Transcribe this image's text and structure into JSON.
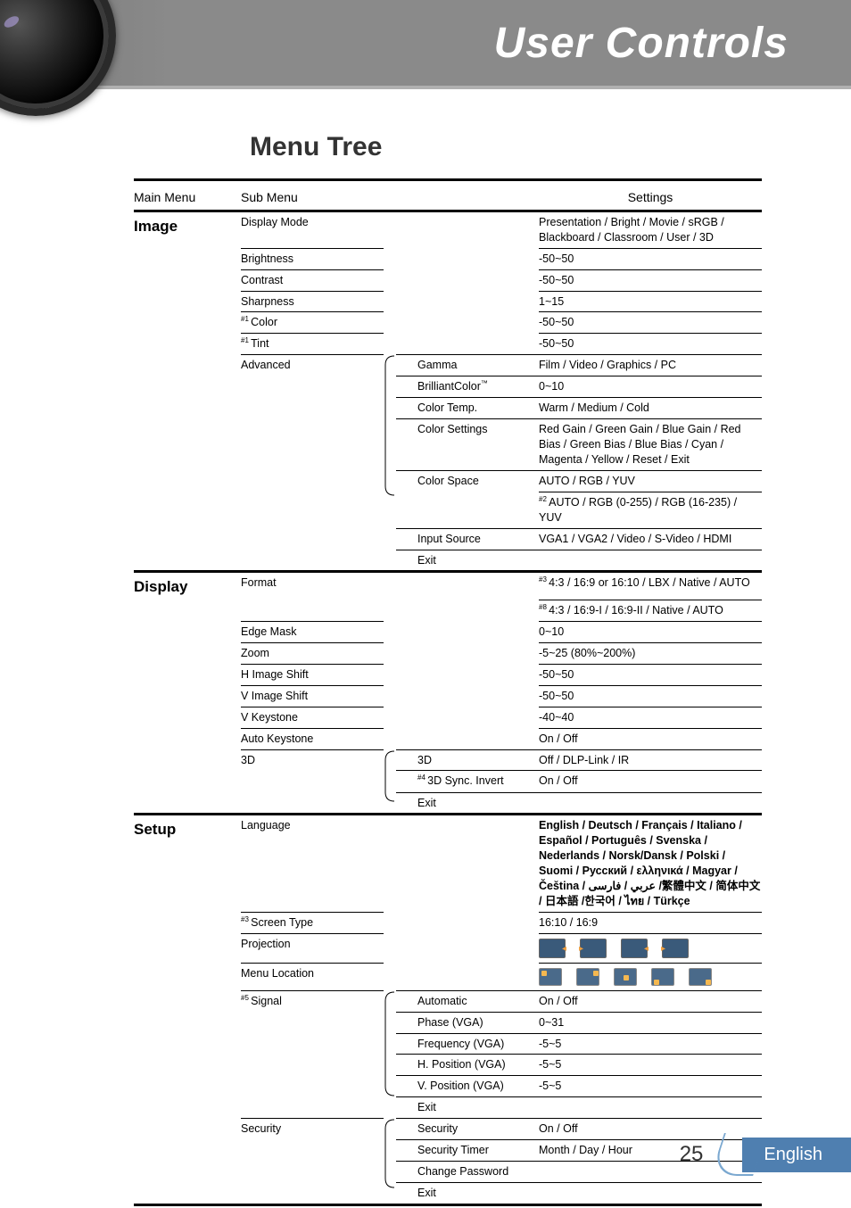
{
  "banner": {
    "title": "User Controls"
  },
  "page": {
    "title": "Menu Tree",
    "number": "25",
    "language": "English"
  },
  "headers": {
    "main": "Main Menu",
    "sub": "Sub Menu",
    "settings": "Settings"
  },
  "sections": [
    {
      "name": "Image",
      "rows": [
        {
          "sub": "Display Mode",
          "mid": "",
          "set": "Presentation / Bright / Movie / sRGB / Blackboard / Classroom / User / 3D"
        },
        {
          "sub": "Brightness",
          "mid": "",
          "set": "-50~50"
        },
        {
          "sub": "Contrast",
          "mid": "",
          "set": "-50~50"
        },
        {
          "sub": "Sharpness",
          "mid": "",
          "set": "1~15"
        },
        {
          "subPrefix": "#1 ",
          "sub": "Color",
          "mid": "",
          "set": "-50~50"
        },
        {
          "subPrefix": "#1 ",
          "sub": "Tint",
          "mid": "",
          "set": "-50~50"
        },
        {
          "sub": "Advanced",
          "mid": "Gamma",
          "set": "Film / Video / Graphics / PC",
          "braceStart": true
        },
        {
          "sub": "",
          "mid": "BrilliantColor™",
          "set": "0~10"
        },
        {
          "sub": "",
          "mid": "Color Temp.",
          "set": "Warm / Medium / Cold"
        },
        {
          "sub": "",
          "mid": "Color Settings",
          "set": "Red Gain / Green Gain / Blue Gain / Red Bias / Green Bias / Blue Bias / Cyan / Magenta / Yellow / Reset / Exit"
        },
        {
          "sub": "",
          "mid": "Color Space",
          "set": "AUTO / RGB / YUV"
        },
        {
          "sub": "",
          "mid": "",
          "setPrefix": "#2 ",
          "set": "AUTO / RGB (0-255) / RGB (16-235) / YUV"
        },
        {
          "sub": "",
          "mid": "Input Source",
          "set": "VGA1 / VGA2 / Video / S-Video / HDMI"
        },
        {
          "sub": "",
          "mid": "Exit",
          "set": "",
          "braceEnd": true
        }
      ]
    },
    {
      "name": "Display",
      "rows": [
        {
          "sub": "Format",
          "mid": "",
          "setPrefix": "#3 ",
          "set": "4:3 / 16:9 or 16:10 / LBX / Native / AUTO"
        },
        {
          "sub": "",
          "mid": "",
          "setPrefix": "#8 ",
          "set": "4:3 / 16:9-I / 16:9-II / Native / AUTO"
        },
        {
          "sub": "Edge Mask",
          "mid": "",
          "set": "0~10"
        },
        {
          "sub": "Zoom",
          "mid": "",
          "set": "-5~25 (80%~200%)"
        },
        {
          "sub": "H Image Shift",
          "mid": "",
          "set": "-50~50"
        },
        {
          "sub": "V Image Shift",
          "mid": "",
          "set": "-50~50"
        },
        {
          "sub": "V Keystone",
          "mid": "",
          "set": "-40~40"
        },
        {
          "sub": "Auto Keystone",
          "mid": "",
          "set": "On / Off"
        },
        {
          "sub": "3D",
          "mid": "3D",
          "set": "Off / DLP-Link / IR",
          "braceStart": true
        },
        {
          "sub": "",
          "midPrefix": "#4 ",
          "mid": "3D Sync. Invert",
          "set": "On / Off"
        },
        {
          "sub": "",
          "mid": "Exit",
          "set": "",
          "braceEnd": true
        }
      ]
    },
    {
      "name": "Setup",
      "rows": [
        {
          "sub": "Language",
          "mid": "",
          "set": "English / Deutsch / Français / Italiano / Español / Português / Svenska / Nederlands / Norsk/Dansk / Polski / Suomi / Русский / ελληνικά / Magyar / Čeština / عربي / فارسی /繁體中文 / 简体中文 / 日本語 /한국어 / ไทย / Türkçe",
          "bold": true
        },
        {
          "subPrefix": "#3 ",
          "sub": "Screen Type",
          "mid": "",
          "set": "16:10 / 16:9"
        },
        {
          "sub": "Projection",
          "mid": "",
          "set": "",
          "projection": true
        },
        {
          "sub": "Menu Location",
          "mid": "",
          "set": "",
          "menulocation": true
        },
        {
          "subPrefix": "#5 ",
          "sub": "Signal",
          "mid": "Automatic",
          "set": "On / Off",
          "braceStart": true
        },
        {
          "sub": "",
          "mid": "Phase (VGA)",
          "set": "0~31"
        },
        {
          "sub": "",
          "mid": "Frequency (VGA)",
          "set": "-5~5"
        },
        {
          "sub": "",
          "mid": "H. Position (VGA)",
          "set": "-5~5"
        },
        {
          "sub": "",
          "mid": "V. Position (VGA)",
          "set": "-5~5"
        },
        {
          "sub": "",
          "mid": "Exit",
          "set": "",
          "braceEnd": true
        },
        {
          "sub": "Security",
          "mid": "Security",
          "set": "On / Off",
          "braceStart": true
        },
        {
          "sub": "",
          "mid": "Security Timer",
          "set": "Month / Day / Hour"
        },
        {
          "sub": "",
          "mid": "Change Password",
          "set": ""
        },
        {
          "sub": "",
          "mid": "Exit",
          "set": "",
          "braceEnd": true
        }
      ]
    }
  ]
}
